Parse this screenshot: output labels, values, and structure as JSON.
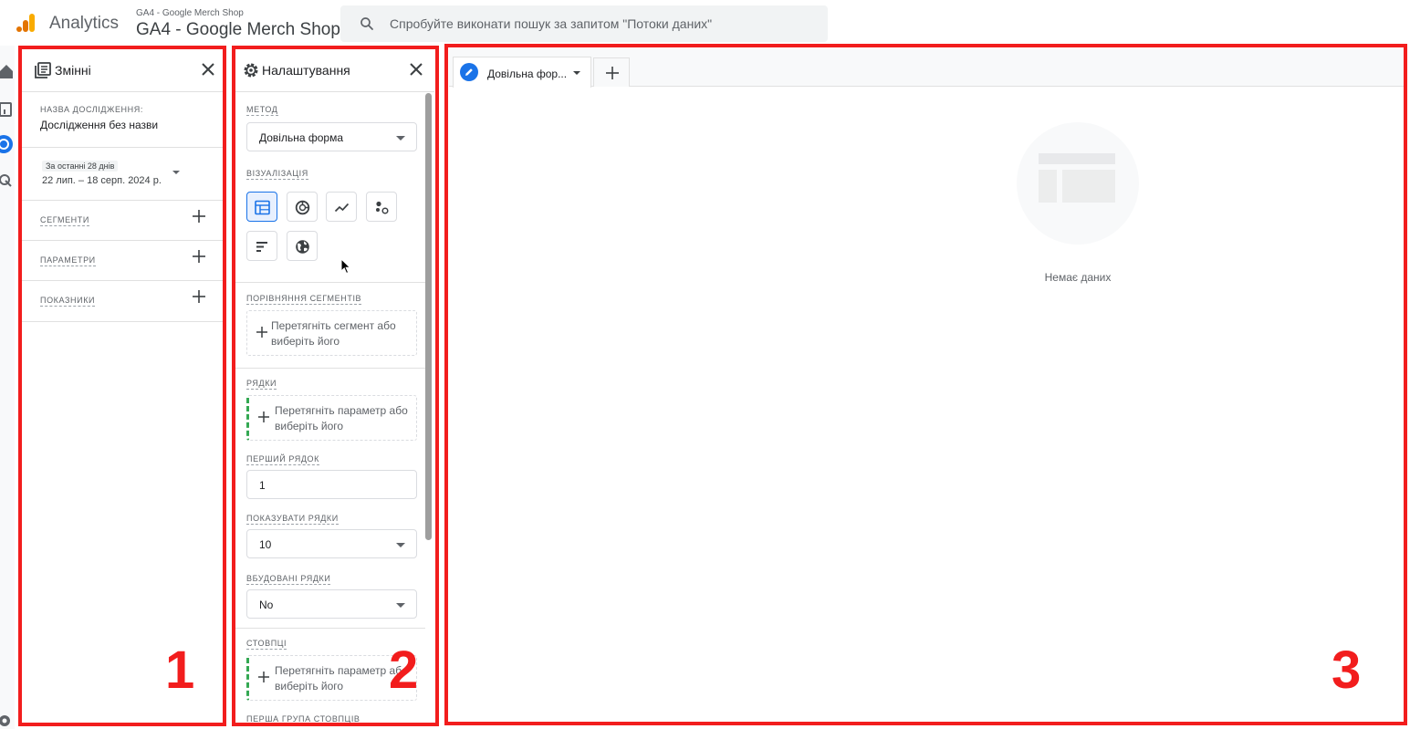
{
  "header": {
    "app_title": "Analytics",
    "account_small": "GA4 - Google Merch Shop",
    "account_big": "GA4 - Google Merch Shop",
    "search_placeholder": "Спробуйте виконати пошук за запитом \"Потоки даних\""
  },
  "variables_panel": {
    "title": "Змінні",
    "exploration_name_label": "НАЗВА ДОСЛІДЖЕННЯ:",
    "exploration_name": "Дослідження без назви",
    "date_chip": "За останні 28 днів",
    "date_range": "22 лип. – 18 серп. 2024 р.",
    "segments_label": "СЕГМЕНТИ",
    "dimensions_label": "ПАРАМЕТРИ",
    "metrics_label": "ПОКАЗНИКИ"
  },
  "settings_panel": {
    "title": "Налаштування",
    "method_label": "МЕТОД",
    "method_value": "Довільна форма",
    "visualization_label": "ВІЗУАЛІЗАЦІЯ",
    "visualizations": [
      "table-icon",
      "donut-chart-icon",
      "line-chart-icon",
      "scatter-plot-icon",
      "bar-chart-icon",
      "geo-map-icon"
    ],
    "segment_comparison_label": "ПОРІВНЯННЯ СЕГМЕНТІВ",
    "segment_drop_text": "Перетягніть сегмент або виберіть його",
    "rows_label": "РЯДКИ",
    "rows_drop_text": "Перетягніть параметр або виберіть його",
    "first_row_label": "ПЕРШИЙ РЯДОК",
    "first_row_value": "1",
    "show_rows_label": "ПОКАЗУВАТИ РЯДКИ",
    "show_rows_value": "10",
    "nested_rows_label": "ВБУДОВАНІ РЯДКИ",
    "nested_rows_value": "No",
    "columns_label": "СТОВПЦІ",
    "columns_drop_text": "Перетягніть параметр або виберіть його",
    "first_column_group_label": "ПЕРША ГРУПА СТОВПЦІВ"
  },
  "canvas": {
    "tab_label": "Довільна фор...",
    "empty_text": "Немає даних"
  },
  "annotations": {
    "marker_1": "1",
    "marker_2": "2",
    "marker_3": "3"
  },
  "colors": {
    "accent": "#1a73e8",
    "highlight_red": "#f21d1d",
    "drop_green": "#34a853"
  }
}
